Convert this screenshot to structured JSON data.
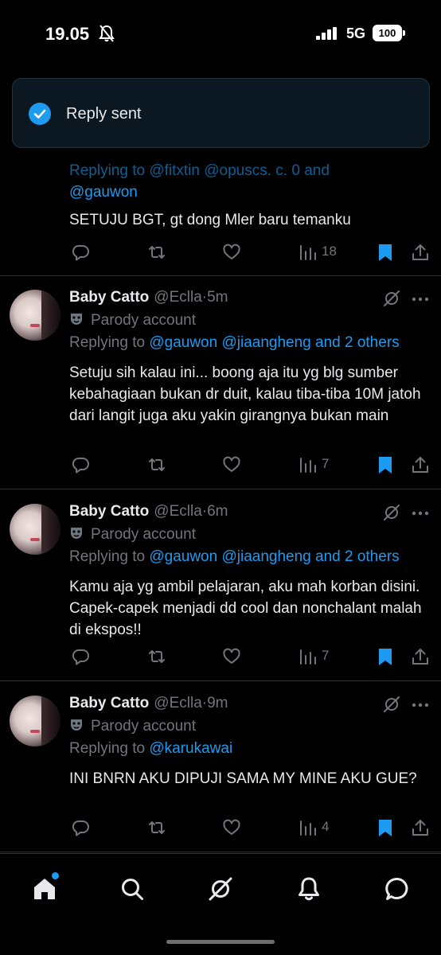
{
  "status_bar": {
    "time": "19.05",
    "network": "5G",
    "battery": "100"
  },
  "toast": {
    "message": "Reply sent"
  },
  "partial_tweet": {
    "hidden_reply_line": "Replying to @fitxtin @opuscs. c. 0 and",
    "mention": "@gauwon",
    "text": "SETUJU BGT, gt dong Mler baru temanku",
    "views": "18"
  },
  "tweets": [
    {
      "display_name": "Baby Catto",
      "handle": "@Eclla",
      "dot": "·",
      "time": "5m",
      "parody_label": "Parody account",
      "reply_prefix": "Replying to",
      "reply_mentions": "@gauwon @jiaangheng and 2 others",
      "text": "Setuju sih kalau ini... boong aja itu yg blg sumber kebahagiaan bukan dr duit, kalau tiba-tiba 10M jatoh dari langit juga aku yakin girangnya bukan main",
      "views": "7"
    },
    {
      "display_name": "Baby Catto",
      "handle": "@Eclla",
      "dot": "·",
      "time": "6m",
      "parody_label": "Parody account",
      "reply_prefix": "Replying to",
      "reply_mentions": "@gauwon @jiaangheng and 2 others",
      "text": "Kamu aja yg ambil pelajaran, aku mah korban disini. Capek-capek menjadi dd cool dan nonchalant malah di ekspos!!",
      "views": "7"
    },
    {
      "display_name": "Baby Catto",
      "handle": "@Eclla",
      "dot": "·",
      "time": "9m",
      "parody_label": "Parody account",
      "reply_prefix": "Replying to",
      "reply_mentions": "@karukawai",
      "text": "INI BNRN AKU DIPUJI SAMA MY MINE AKU GUE?",
      "views": "4"
    }
  ],
  "icons": {
    "mute": "bell-slash-icon",
    "signal": "signal-bars-icon",
    "check": "check-circle-icon",
    "reply": "reply-icon",
    "retweet": "retweet-icon",
    "like": "heart-icon",
    "views": "views-bars-icon",
    "bookmark": "bookmark-filled-icon",
    "share": "share-icon",
    "grok": "grok-icon",
    "more": "more-dots-icon",
    "parody": "theater-mask-icon",
    "home": "home-icon",
    "search": "search-icon",
    "notifications": "bell-icon",
    "messages": "message-bubble-icon"
  },
  "colors": {
    "accent": "#1d9bf0",
    "background": "#000000",
    "secondary_text": "#71767b",
    "divider": "#2f3336"
  }
}
